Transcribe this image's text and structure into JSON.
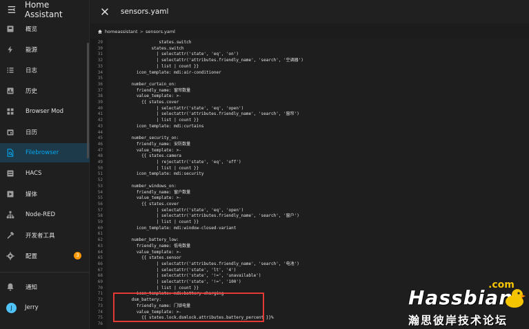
{
  "app": {
    "title": "Home Assistant"
  },
  "sidebar": {
    "items": [
      {
        "label": "概览",
        "icon": "dashboard-icon"
      },
      {
        "label": "能源",
        "icon": "lightning-icon"
      },
      {
        "label": "日志",
        "icon": "list-icon"
      },
      {
        "label": "历史",
        "icon": "chart-icon"
      },
      {
        "label": "Browser Mod",
        "icon": "browser-mod-icon"
      },
      {
        "label": "日历",
        "icon": "calendar-icon"
      },
      {
        "label": "Filebrowser",
        "icon": "file-search-icon",
        "active": true
      },
      {
        "label": "HACS",
        "icon": "hacs-icon"
      },
      {
        "label": "媒体",
        "icon": "media-icon"
      },
      {
        "label": "Node-RED",
        "icon": "sitemap-icon"
      },
      {
        "label": "开发者工具",
        "icon": "hammer-icon"
      },
      {
        "label": "配置",
        "icon": "gear-icon",
        "badge": "3"
      }
    ],
    "notifications_label": "通知",
    "user": {
      "initial": "J",
      "name": "Jerry"
    }
  },
  "editor": {
    "filename": "sensors.yaml",
    "breadcrumb": [
      "homeassistant",
      "sensors.yaml"
    ],
    "lines": [
      {
        "n": "29",
        "t": "                 states.switch"
      },
      {
        "n": "30",
        "t": "              states.switch"
      },
      {
        "n": "31",
        "t": "                | selectattr('state', 'eq', 'on')"
      },
      {
        "n": "32",
        "t": "                | selectattr('attributes.friendly_name', 'search', '空调器')"
      },
      {
        "n": "33",
        "t": "                | list | count }}"
      },
      {
        "n": "34",
        "t": "        icon_template: mdi:air-conditioner"
      },
      {
        "n": "35",
        "t": ""
      },
      {
        "n": "36",
        "t": "      number_curtain_on:"
      },
      {
        "n": "37",
        "t": "        friendly_name: 窗帘数量"
      },
      {
        "n": "38",
        "t": "        value_template: >-"
      },
      {
        "n": "39",
        "t": "          {{ states.cover"
      },
      {
        "n": "40",
        "t": "                | selectattr('state', 'eq', 'open')"
      },
      {
        "n": "41",
        "t": "                | selectattr('attributes.friendly_name', 'search', '窗帘')"
      },
      {
        "n": "42",
        "t": "                | list | count }}"
      },
      {
        "n": "43",
        "t": "        icon_template: mdi:curtains"
      },
      {
        "n": "44",
        "t": ""
      },
      {
        "n": "45",
        "t": "      number_security_on:"
      },
      {
        "n": "46",
        "t": "        friendly_name: 安防数量"
      },
      {
        "n": "47",
        "t": "        value_template: >-"
      },
      {
        "n": "48",
        "t": "          {{ states.camera"
      },
      {
        "n": "49",
        "t": "                | rejectattr('state', 'eq', 'off')"
      },
      {
        "n": "50",
        "t": "                | list | count }}"
      },
      {
        "n": "51",
        "t": "        icon_template: mdi:security"
      },
      {
        "n": "52",
        "t": ""
      },
      {
        "n": "53",
        "t": "      number_windows_on:"
      },
      {
        "n": "54",
        "t": "        friendly_name: 窗户数量"
      },
      {
        "n": "55",
        "t": "        value_template: >-"
      },
      {
        "n": "56",
        "t": "          {{ states.cover"
      },
      {
        "n": "57",
        "t": "                | selectattr('state', 'eq', 'open')"
      },
      {
        "n": "58",
        "t": "                | selectattr('attributes.friendly_name', 'search', '窗户')"
      },
      {
        "n": "59",
        "t": "                | list | count }}"
      },
      {
        "n": "60",
        "t": "        icon_template: mdi:window-closed-variant"
      },
      {
        "n": "61",
        "t": ""
      },
      {
        "n": "62",
        "t": "      number_battery_low:"
      },
      {
        "n": "63",
        "t": "        friendly_name: 低电数量"
      },
      {
        "n": "64",
        "t": "        value_template: >-"
      },
      {
        "n": "65",
        "t": "          {{ states.sensor"
      },
      {
        "n": "66",
        "t": "                | selectattr('attributes.friendly_name', 'search', '电池')"
      },
      {
        "n": "67",
        "t": "                | selectattr('state', 'lt', '4')"
      },
      {
        "n": "68",
        "t": "                | selectattr('state', '!=', 'unavailable')"
      },
      {
        "n": "69",
        "t": "                | selectattr('state', '!=', '100')"
      },
      {
        "n": "70",
        "t": "                | list | count }}"
      },
      {
        "n": "71",
        "t": "        icon_template: mdi:battery-charging"
      },
      {
        "n": "72",
        "t": "      dsm_battery:"
      },
      {
        "n": "73",
        "t": "        friendly_name: 门锁电量"
      },
      {
        "n": "74",
        "t": "        value_template: >-"
      },
      {
        "n": "75",
        "t": "          {{ states.lock.dsmlock.attributes.battery_percent }}%"
      },
      {
        "n": "76",
        "t": ""
      }
    ]
  },
  "watermark": {
    "com": ".com",
    "main": "Hassbian",
    "sub": "瀚思彼岸技术论坛"
  },
  "colors": {
    "accent": "#03a9f4",
    "badge": "#ff9800",
    "highlight_box": "#e53935"
  }
}
